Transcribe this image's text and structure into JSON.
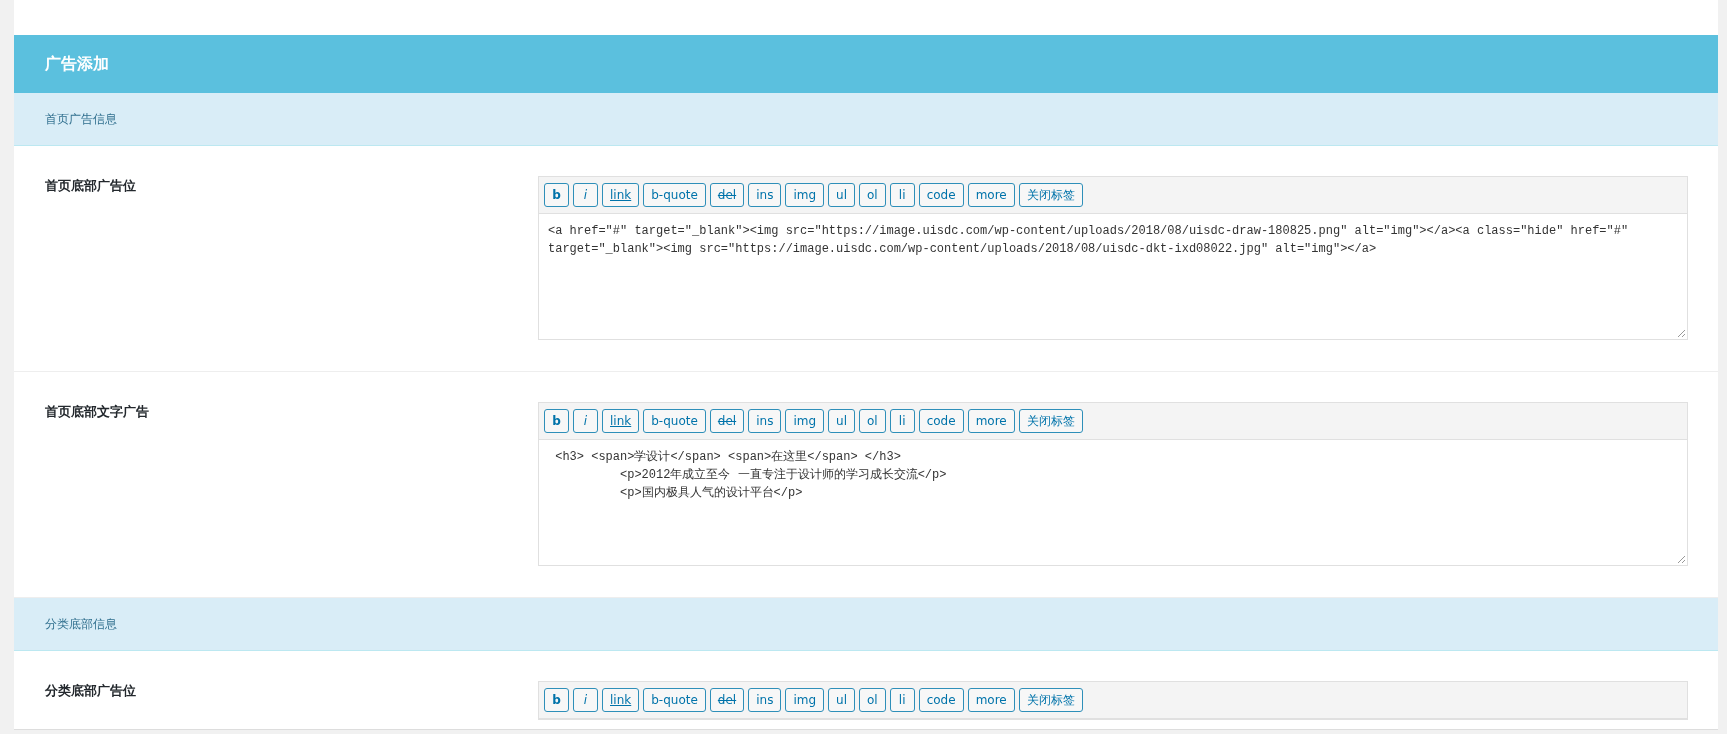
{
  "panel": {
    "title": "广告添加",
    "sections": [
      {
        "title": "首页广告信息",
        "fields": [
          {
            "label": "首页底部广告位",
            "toolbar": [
              {
                "label": "b",
                "kind": "bold"
              },
              {
                "label": "i",
                "kind": "italic"
              },
              {
                "label": "link",
                "kind": "underline"
              },
              {
                "label": "b-quote",
                "kind": "plain"
              },
              {
                "label": "del",
                "kind": "strike"
              },
              {
                "label": "ins",
                "kind": "plain"
              },
              {
                "label": "img",
                "kind": "plain"
              },
              {
                "label": "ul",
                "kind": "plain"
              },
              {
                "label": "ol",
                "kind": "plain"
              },
              {
                "label": "li",
                "kind": "plain"
              },
              {
                "label": "code",
                "kind": "plain"
              },
              {
                "label": "more",
                "kind": "plain"
              },
              {
                "label": "关闭标签",
                "kind": "plain"
              }
            ],
            "value": "<a href=\"#\" target=\"_blank\"><img src=\"https://image.uisdc.com/wp-content/uploads/2018/08/uisdc-draw-180825.png\" alt=\"img\"></a><a class=\"hide\" href=\"#\" target=\"_blank\"><img src=\"https://image.uisdc.com/wp-content/uploads/2018/08/uisdc-dkt-ixd08022.jpg\" alt=\"img\"></a>"
          },
          {
            "label": "首页底部文字广告",
            "toolbar": [
              {
                "label": "b",
                "kind": "bold"
              },
              {
                "label": "i",
                "kind": "italic"
              },
              {
                "label": "link",
                "kind": "underline"
              },
              {
                "label": "b-quote",
                "kind": "plain"
              },
              {
                "label": "del",
                "kind": "strike"
              },
              {
                "label": "ins",
                "kind": "plain"
              },
              {
                "label": "img",
                "kind": "plain"
              },
              {
                "label": "ul",
                "kind": "plain"
              },
              {
                "label": "ol",
                "kind": "plain"
              },
              {
                "label": "li",
                "kind": "plain"
              },
              {
                "label": "code",
                "kind": "plain"
              },
              {
                "label": "more",
                "kind": "plain"
              },
              {
                "label": "关闭标签",
                "kind": "plain"
              }
            ],
            "value": " <h3> <span>学设计</span> <span>在这里</span> </h3>\n          <p>2012年成立至今 一直专注于设计师的学习成长交流</p>\n          <p>国内极具人气的设计平台</p>"
          }
        ]
      },
      {
        "title": "分类底部信息",
        "fields": [
          {
            "label": "分类底部广告位",
            "toolbar": [
              {
                "label": "b",
                "kind": "bold"
              },
              {
                "label": "i",
                "kind": "italic"
              },
              {
                "label": "link",
                "kind": "underline"
              },
              {
                "label": "b-quote",
                "kind": "plain"
              },
              {
                "label": "del",
                "kind": "strike"
              },
              {
                "label": "ins",
                "kind": "plain"
              },
              {
                "label": "img",
                "kind": "plain"
              },
              {
                "label": "ul",
                "kind": "plain"
              },
              {
                "label": "ol",
                "kind": "plain"
              },
              {
                "label": "li",
                "kind": "plain"
              },
              {
                "label": "code",
                "kind": "plain"
              },
              {
                "label": "more",
                "kind": "plain"
              },
              {
                "label": "关闭标签",
                "kind": "plain"
              }
            ]
          }
        ]
      }
    ]
  }
}
